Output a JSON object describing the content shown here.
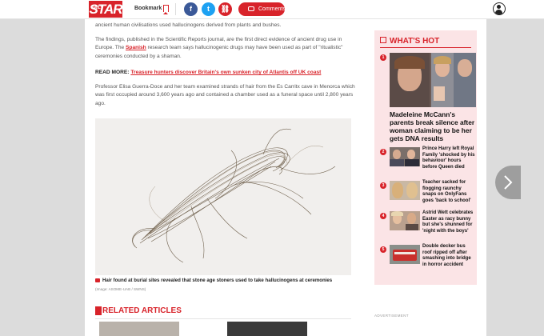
{
  "header": {
    "logo_top": "DAILY",
    "logo": "STAR",
    "bookmark_label": "Bookmark",
    "comments_label": "Comments",
    "social": {
      "facebook": "f",
      "twitter": "t",
      "link": "⛓"
    }
  },
  "article": {
    "p1": "ancient human civilisations used hallucinogens derived from plants and bushes.",
    "p2_a": "The findings, published in the Scientific Reports journal, are the first direct evidence of ancient drug use in Europe. The ",
    "p2_link": "Spanish",
    "p2_b": " research team says hallucinogenic drugs may have been used as part of \"ritualistic\" ceremonies conducted by a shaman.",
    "read_more_label": "READ MORE:",
    "read_more_link": "Treasure hunters discover Britain's own sunken city of Atlantis off UK coast",
    "p3": "Professor Elisa Guerra-Doce and her team examined strands of hair from the Es Carritx cave in Menorca which was first occupied around 3,600 years ago and contained a chamber used as a funeral space until 2,800 years ago.",
    "caption": "Hair found at burial sites revealed that stone age stoners used to take hallucinogens at ceremonies",
    "credit": "(Image: ASOME-UAB / SWNS)"
  },
  "related": {
    "heading": "RELATED ARTICLES"
  },
  "sidebar": {
    "heading": "WHAT'S HOT",
    "items": [
      {
        "num": "1",
        "title": "Madeleine McCann's parents break silence after woman claiming to be her gets DNA results"
      },
      {
        "num": "2",
        "title": "Prince Harry left Royal Family 'shocked by his behaviour' hours before Queen died"
      },
      {
        "num": "3",
        "title": "Teacher sacked for flogging raunchy snaps on OnlyFans goes 'back to school'"
      },
      {
        "num": "4",
        "title": "Astrid Wett celebrates Easter as racy bunny but she's shunned for 'night with the boys'"
      },
      {
        "num": "5",
        "title": "Double decker bus roof ripped off after smashing into bridge in horror accident"
      }
    ],
    "advert_label": "ADVERTISEMENT"
  },
  "colors": {
    "accent": "#d8232a",
    "sidebar_bg": "#fbe4e6"
  }
}
